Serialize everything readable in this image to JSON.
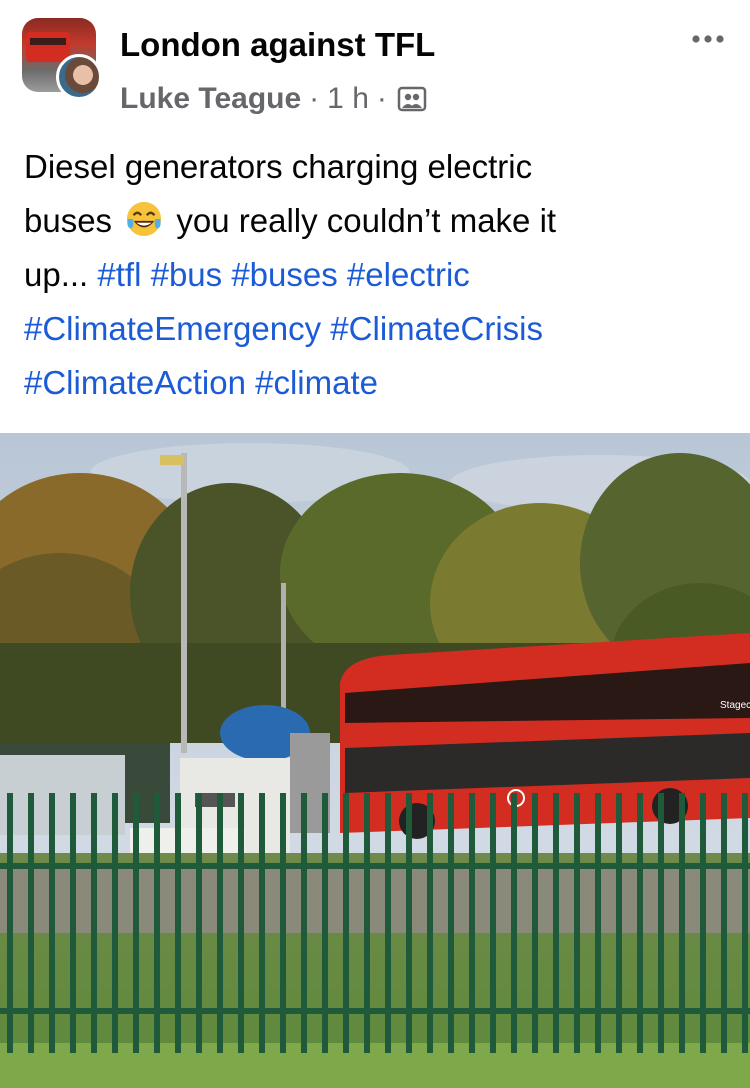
{
  "post": {
    "group_name": "London against TFL",
    "author": "Luke Teague",
    "separator": "·",
    "time": "1 h",
    "audience_icon": "group-audience-icon",
    "more_icon": "more-options-icon"
  },
  "caption": {
    "text_line1": "Diesel generators charging electric",
    "text_line2a": "buses",
    "emoji": "face-with-tears-of-joy",
    "text_line2b": "you really couldn’t make it",
    "text_line3": "up...",
    "hashtags": [
      "#tfl",
      "#bus",
      "#buses",
      "#electric",
      "#ClimateEmergency",
      "#ClimateCrisis",
      "#ClimateAction",
      "#climate"
    ]
  },
  "photo": {
    "subject": "photo-bus-charging",
    "bus_operator": "Stagecoach"
  },
  "colors": {
    "hashtag": "#1c5bd6",
    "meta": "#65676b",
    "bus_red": "#d32d22"
  }
}
